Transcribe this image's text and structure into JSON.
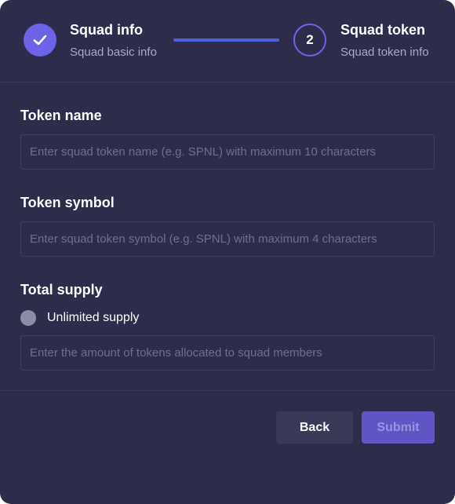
{
  "stepper": {
    "steps": [
      {
        "title": "Squad info",
        "subtitle": "Squad basic info",
        "status": "completed",
        "icon": "check-icon"
      },
      {
        "title": "Squad token",
        "subtitle": "Squad token info",
        "status": "active",
        "number": "2"
      }
    ]
  },
  "form": {
    "token_name": {
      "label": "Token name",
      "value": "",
      "placeholder": "Enter squad token name (e.g. SPNL) with maximum 10 characters"
    },
    "token_symbol": {
      "label": "Token symbol",
      "value": "",
      "placeholder": "Enter squad token symbol (e.g. SPNL) with maximum 4 characters"
    },
    "total_supply": {
      "label": "Total supply",
      "unlimited_label": "Unlimited supply",
      "unlimited_checked": false,
      "value": "",
      "placeholder": "Enter the amount of tokens allocated to squad members"
    }
  },
  "actions": {
    "back_label": "Back",
    "submit_label": "Submit",
    "submit_enabled": false
  },
  "colors": {
    "background": "#2d2c4b",
    "accent": "#6c63e6",
    "connector": "#4b62d8",
    "submit": "#5f55c5",
    "back": "#393857",
    "muted_text": "#a9a8c6"
  }
}
